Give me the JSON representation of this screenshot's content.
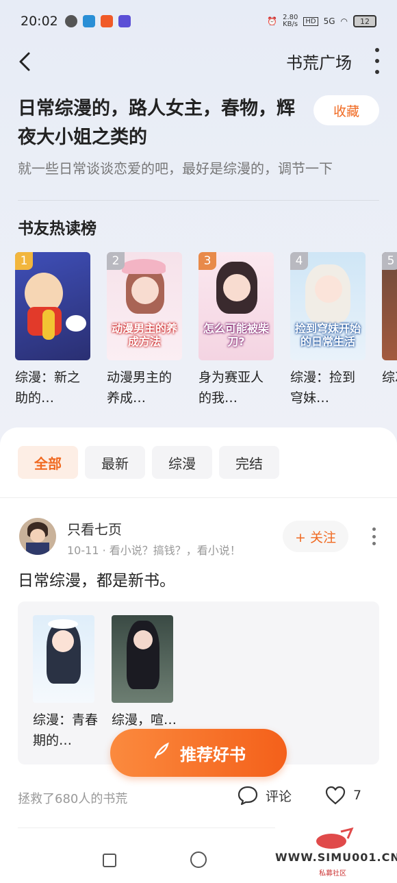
{
  "status": {
    "time": "20:02",
    "net_speed": "2.80\nKB/s",
    "hd": "HD",
    "signal": "5G",
    "battery": "12"
  },
  "topbar": {
    "title": "书荒广场"
  },
  "topic": {
    "title": "日常综漫的，路人女主，春物，辉夜大小姐之类的",
    "collect_label": "收藏",
    "description": "就一些日常谈谈恋爱的吧，最好是综漫的，调节一下"
  },
  "hot": {
    "title": "书友热读榜",
    "books": [
      {
        "rank": "1",
        "name": "综漫：新之助的…",
        "cover_text": ""
      },
      {
        "rank": "2",
        "name": "动漫男主的养成…",
        "cover_text": "动漫男主的养成方法"
      },
      {
        "rank": "3",
        "name": "身为赛亚人的我…",
        "cover_text": "怎么可能被柴刀?"
      },
      {
        "rank": "4",
        "name": "综漫：捡到穹妹…",
        "cover_text": "捡到穹妹开始的日常生活"
      },
      {
        "rank": "5",
        "name": "综次…",
        "cover_text": ""
      }
    ]
  },
  "tabs": [
    "全部",
    "最新",
    "综漫",
    "完结"
  ],
  "post": {
    "user": "只看七页",
    "meta": "10-11 · 看小说？搞钱？，看小说！",
    "follow_label": "+ 关注",
    "text": "日常综漫，都是新书。",
    "books": [
      {
        "name": "综漫：青春期的…"
      },
      {
        "name": "综漫，喧…"
      }
    ],
    "saved_text": "拯救了680人的书荒",
    "comment_label": "评论",
    "like_count": "7"
  },
  "fab": {
    "label": "推荐好书"
  },
  "watermark": {
    "text": "WWW.SIMU001.CN",
    "sub": "私募社区"
  },
  "colors": {
    "accent": "#f06a22",
    "rank1": "#f2b63d",
    "rank2": "#b9b9c0",
    "rank3": "#e88a4a"
  }
}
